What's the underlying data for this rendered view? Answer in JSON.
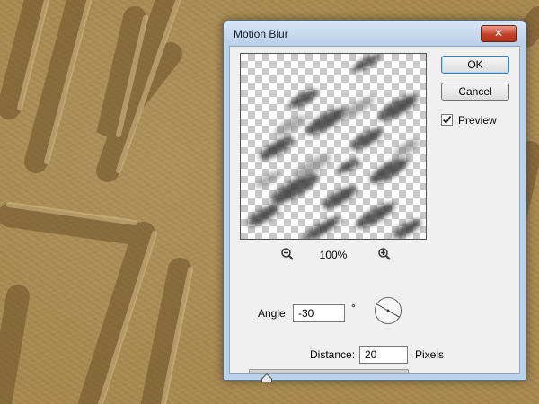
{
  "dialog": {
    "title": "Motion Blur",
    "close_label": "✕"
  },
  "buttons": {
    "ok_label": "OK",
    "cancel_label": "Cancel"
  },
  "preview_option": {
    "label": "Preview",
    "checked": true
  },
  "zoom": {
    "level": "100%"
  },
  "angle": {
    "label": "Angle:",
    "value": "-30",
    "unit": "°"
  },
  "distance": {
    "label": "Distance:",
    "value": "20",
    "unit": "Pixels",
    "slider_fraction": 0.08
  },
  "icons": [
    "zoom-out-icon",
    "zoom-in-icon",
    "checkmark-icon",
    "angle-dial-icon",
    "slider-thumb-icon",
    "close-icon"
  ]
}
